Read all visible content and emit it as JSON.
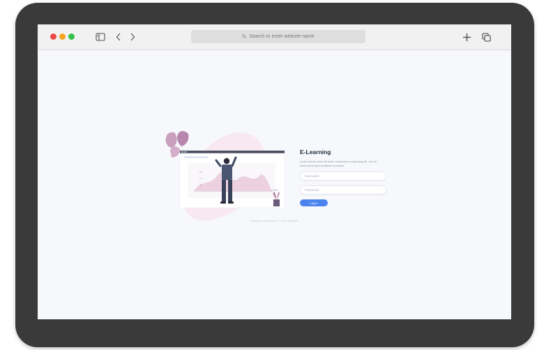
{
  "browser": {
    "url_placeholder": "Search or enter website name",
    "icons": [
      "sidebar-icon",
      "chevron-left-icon",
      "chevron-right-icon",
      "search-icon",
      "plus-icon",
      "tabs-icon"
    ],
    "traffic_lights": [
      "#ee4b45",
      "#f5a623",
      "#35c048"
    ]
  },
  "login": {
    "title": "E-Learning",
    "description": "Lorem ipsum dolor sit amet, consectetur adipiscing elit, sed do eiusmod tempor incididunt ut labore.",
    "username_placeholder": "Username",
    "password_placeholder": "Password",
    "button_label": "Log in",
    "accent_color": "#4a83ee"
  },
  "footer": {
    "text": "Design by Rosamaria • © 2026 Dribbble"
  },
  "illustration": {
    "badge": "LOGO"
  }
}
